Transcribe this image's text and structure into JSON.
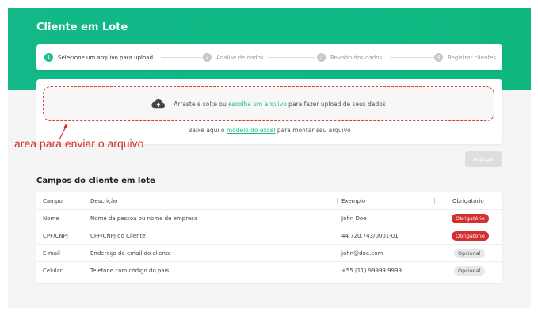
{
  "page": {
    "title": "Cliente em Lote"
  },
  "stepper": {
    "steps": [
      {
        "num": "1",
        "label": "Selecione um arquivo para upload",
        "active": true
      },
      {
        "num": "2",
        "label": "Análise de dados",
        "active": false
      },
      {
        "num": "3",
        "label": "Revisão dos dados",
        "active": false
      },
      {
        "num": "4",
        "label": "Registrar clientes",
        "active": false
      }
    ]
  },
  "upload": {
    "text_before": "Arraste e solte ou ",
    "link": "escolha um arquivo",
    "text_after": " para fazer upload de seus dados",
    "download_before": "Baixe aqui o ",
    "download_link": "modelo do excel",
    "download_after": " para montar seu arquivo"
  },
  "annotation": {
    "text": "area para enviar o arquivo",
    "color": "#d32f2f"
  },
  "actions": {
    "next_label": "Avançar"
  },
  "fields_section": {
    "title": "Campos do cliente em lote",
    "headers": {
      "field": "Campo",
      "description": "Descrição",
      "example": "Exemplo",
      "required": "Obrigatório"
    },
    "rows": [
      {
        "field": "Nome",
        "description": "Nome da pessoa ou nome de empresa",
        "example": "John Doe",
        "required": "Obrigatório",
        "status": "required"
      },
      {
        "field": "CPF/CNPJ",
        "description": "CPF/CNPJ do Cliente",
        "example": "44.720.743/0001-01",
        "required": "Obrigatório",
        "status": "required"
      },
      {
        "field": "E-mail",
        "description": "Endereço de email do cliente",
        "example": "john@doe.com",
        "required": "Opcional",
        "status": "optional"
      },
      {
        "field": "Celular",
        "description": "Telefone com código do país",
        "example": "+55 (11) 99999 9999",
        "required": "Opcional",
        "status": "optional"
      }
    ]
  },
  "colors": {
    "brand": "#14b889",
    "required": "#d32f2f",
    "link": "#1fb98a"
  },
  "icons": {
    "upload": "cloud-upload-icon"
  }
}
